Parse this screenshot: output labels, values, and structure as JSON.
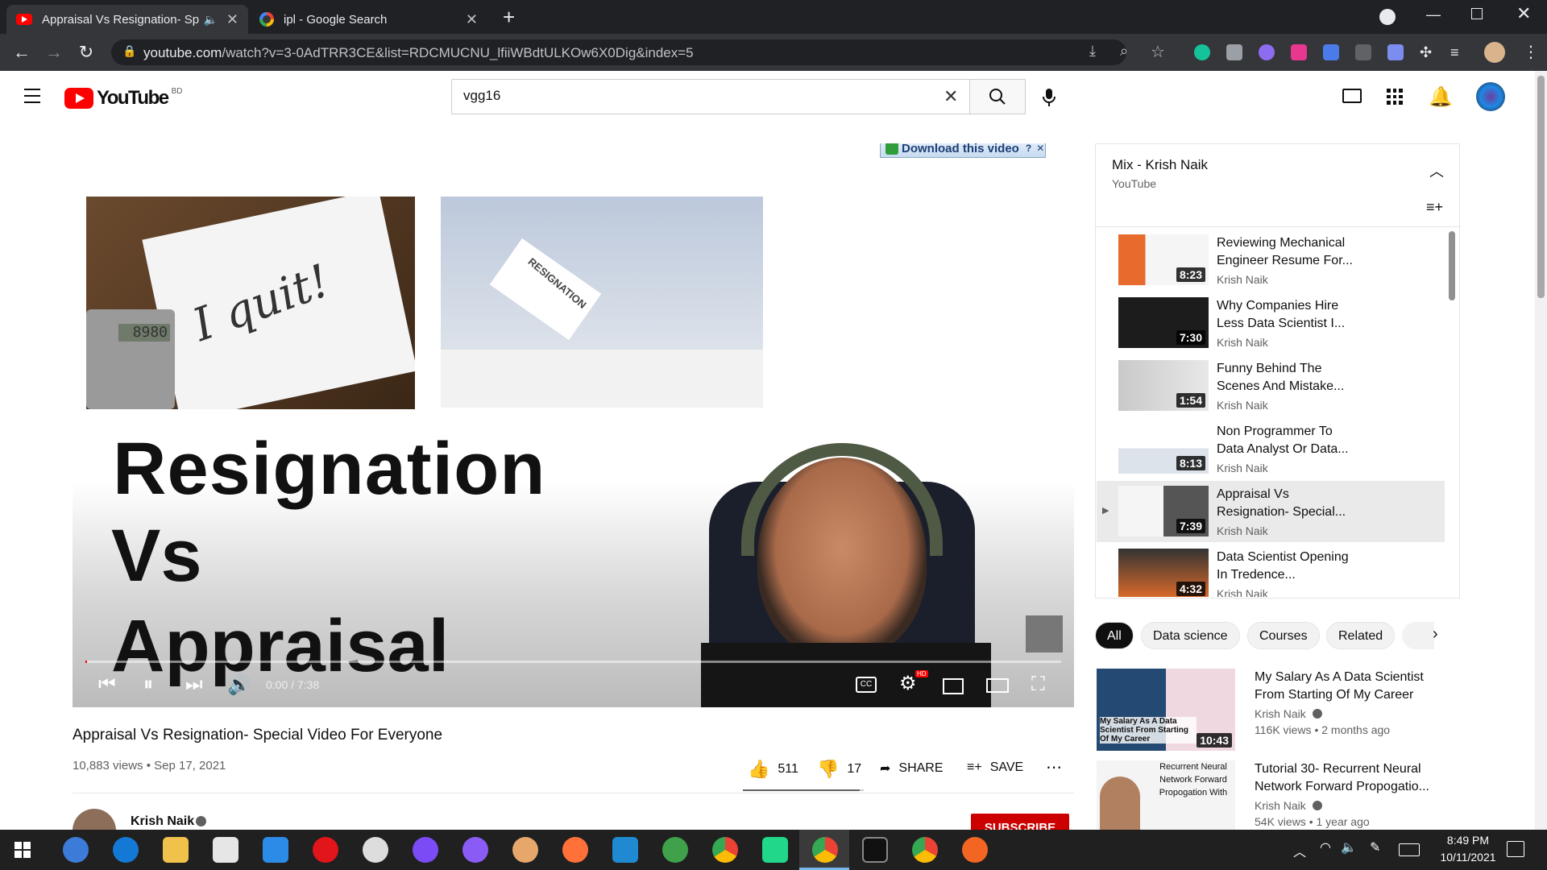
{
  "browser": {
    "tabs": [
      {
        "title": "Appraisal Vs Resignation- Sp",
        "active": true
      },
      {
        "title": "ipl - Google Search",
        "active": false
      }
    ],
    "url_host": "youtube.com",
    "url_path": "/watch?v=3-0AdTRR3CE&list=RDCMUCNU_lfiiWBdtULKOw6X0Dig&index=5"
  },
  "header": {
    "logo_text": "YouTube",
    "country": "BD",
    "search_value": "vgg16"
  },
  "player": {
    "download_label": "Download this video",
    "title_line1": "Resignation",
    "title_line2": "Vs",
    "title_line3": "Appraisal",
    "paper_text": "I quit!",
    "envelope_text": "RESIGNATION",
    "calc_display": "8980",
    "time": "0:00 / 7:38",
    "hd_badge": "HD"
  },
  "video": {
    "title": "Appraisal Vs Resignation- Special Video For Everyone",
    "views_date": "10,883 views • Sep 17, 2021",
    "likes": "511",
    "dislikes": "17",
    "share": "SHARE",
    "save": "SAVE",
    "channel": "Krish Naik",
    "subscribe": "SUBSCRIBE"
  },
  "playlist": {
    "title": "Mix - Krish Naik",
    "subtitle": "YouTube",
    "items": [
      {
        "title": "Reviewing Mechanical Engineer Resume For...",
        "channel": "Krish Naik",
        "duration": "8:23"
      },
      {
        "title": "Why Companies Hire Less Data Scientist I...",
        "channel": "Krish Naik",
        "duration": "7:30"
      },
      {
        "title": "Funny Behind The Scenes And Mistake...",
        "channel": "Krish Naik",
        "duration": "1:54"
      },
      {
        "title": "Non Programmer To Data Analyst Or Data...",
        "channel": "Krish Naik",
        "duration": "8:13"
      },
      {
        "title": "Appraisal Vs Resignation- Special...",
        "channel": "Krish Naik",
        "duration": "7:39"
      },
      {
        "title": "Data Scientist Opening In Tredence...",
        "channel": "Krish Naik",
        "duration": "4:32"
      }
    ]
  },
  "chips": [
    "All",
    "Data science",
    "Courses",
    "Related"
  ],
  "related": [
    {
      "title": "My Salary As A Data Scientist From Starting Of My Career",
      "channel": "Krish Naik",
      "meta": "116K views • 2 months ago",
      "duration": "10:43",
      "thumb_text": "My Salary As A Data Scientist From Starting Of My Career"
    },
    {
      "title": "Tutorial 30- Recurrent Neural Network Forward Propogatio...",
      "channel": "Krish Naik",
      "meta": "54K views • 1 year ago",
      "duration": "",
      "thumb_text": "Recurrent Neural Network Forward Propogation With"
    }
  ],
  "taskbar": {
    "time": "8:49 PM",
    "date": "10/11/2021"
  }
}
